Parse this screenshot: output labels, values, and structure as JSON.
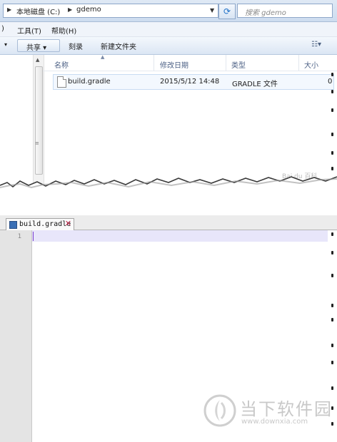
{
  "explorer": {
    "breadcrumb": [
      "本地磁盘 (C:)",
      "gdemo"
    ],
    "search_placeholder": "搜索 gdemo",
    "menu": [
      "工具(T)",
      "帮助(H)"
    ],
    "menu_cut_prefix": ")",
    "toolbar": {
      "share": "共享 ▾",
      "burn": "刻录",
      "new_folder": "新建文件夹"
    },
    "columns": [
      "名称",
      "修改日期",
      "类型",
      "大小"
    ],
    "files": [
      {
        "name": "build.gradle",
        "modified": "2015/5/12 14:48",
        "type": "GRADLE 文件",
        "size": "0"
      }
    ],
    "watermark_small": "Bai du 百科"
  },
  "editor": {
    "tab_label": "build.gradle",
    "line_numbers": [
      "1"
    ]
  },
  "watermark": {
    "brand": "当下软件园",
    "url": "www.downxia.com"
  }
}
